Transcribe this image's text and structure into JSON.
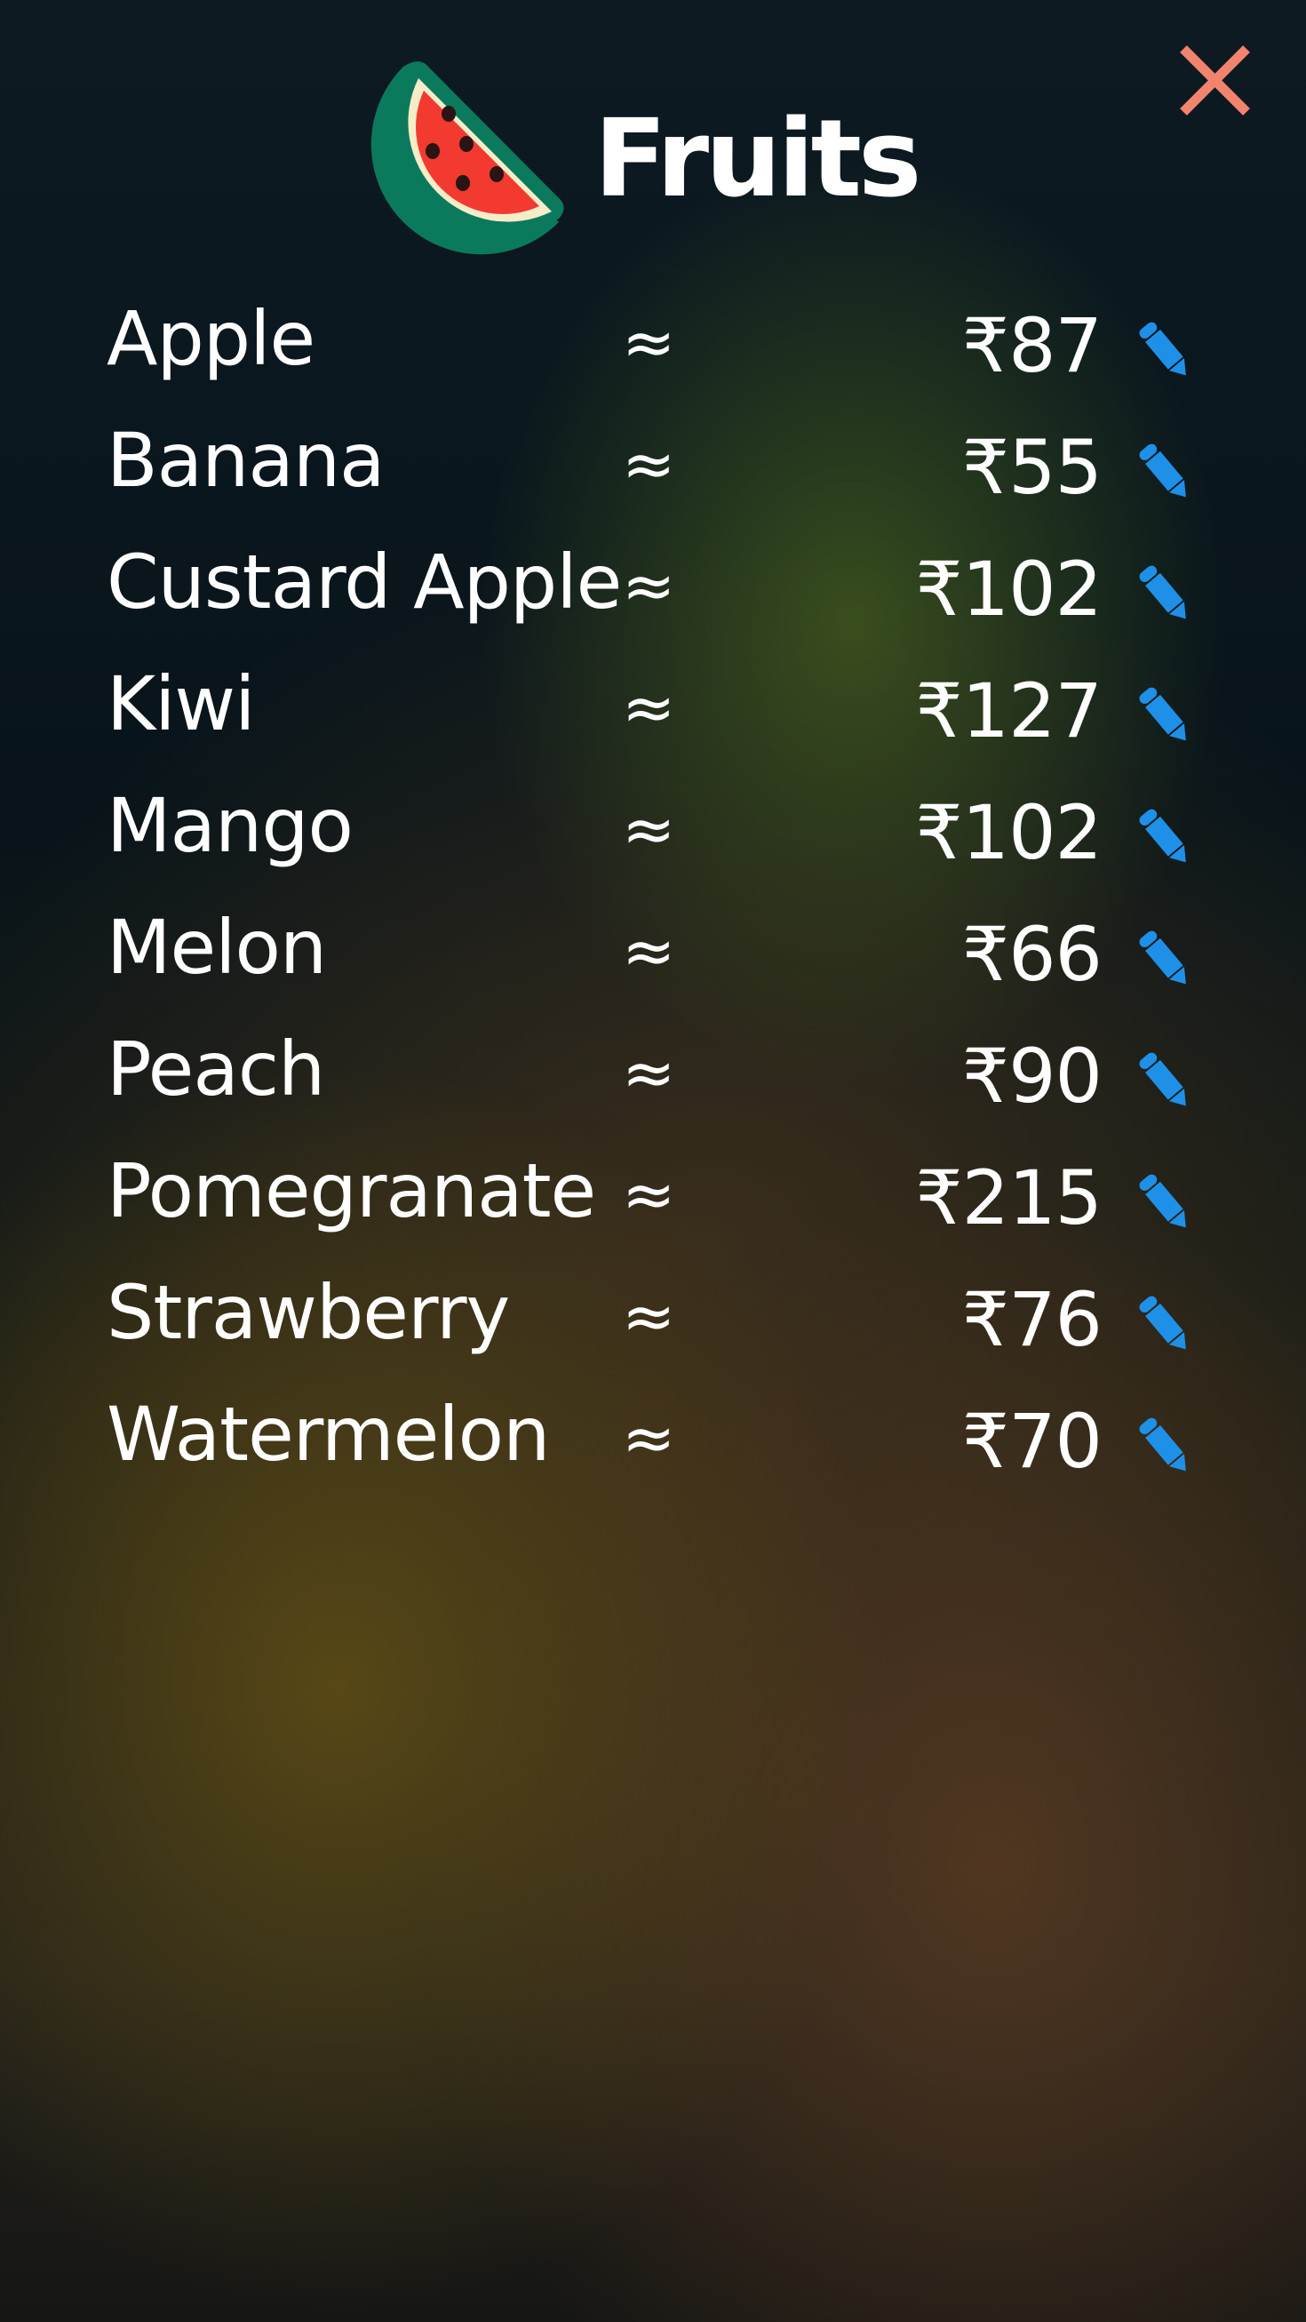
{
  "header": {
    "title": "Fruits",
    "logo_icon": "watermelon-icon",
    "close_icon": "close-icon"
  },
  "colors": {
    "close": "#f2846d",
    "edit": "#1e90e8",
    "text": "#ffffff"
  },
  "items": [
    {
      "name": "Apple",
      "approx": "≈",
      "price": "₹87",
      "edit_icon": "pencil-icon"
    },
    {
      "name": "Banana",
      "approx": "≈",
      "price": "₹55",
      "edit_icon": "pencil-icon"
    },
    {
      "name": "Custard Apple",
      "approx": "≈",
      "price": "₹102",
      "edit_icon": "pencil-icon"
    },
    {
      "name": "Kiwi",
      "approx": "≈",
      "price": "₹127",
      "edit_icon": "pencil-icon"
    },
    {
      "name": "Mango",
      "approx": "≈",
      "price": "₹102",
      "edit_icon": "pencil-icon"
    },
    {
      "name": "Melon",
      "approx": "≈",
      "price": "₹66",
      "edit_icon": "pencil-icon"
    },
    {
      "name": "Peach",
      "approx": "≈",
      "price": "₹90",
      "edit_icon": "pencil-icon"
    },
    {
      "name": "Pomegranate",
      "approx": "≈",
      "price": "₹215",
      "edit_icon": "pencil-icon"
    },
    {
      "name": "Strawberry",
      "approx": "≈",
      "price": "₹76",
      "edit_icon": "pencil-icon"
    },
    {
      "name": "Watermelon",
      "approx": "≈",
      "price": "₹70",
      "edit_icon": "pencil-icon"
    }
  ]
}
